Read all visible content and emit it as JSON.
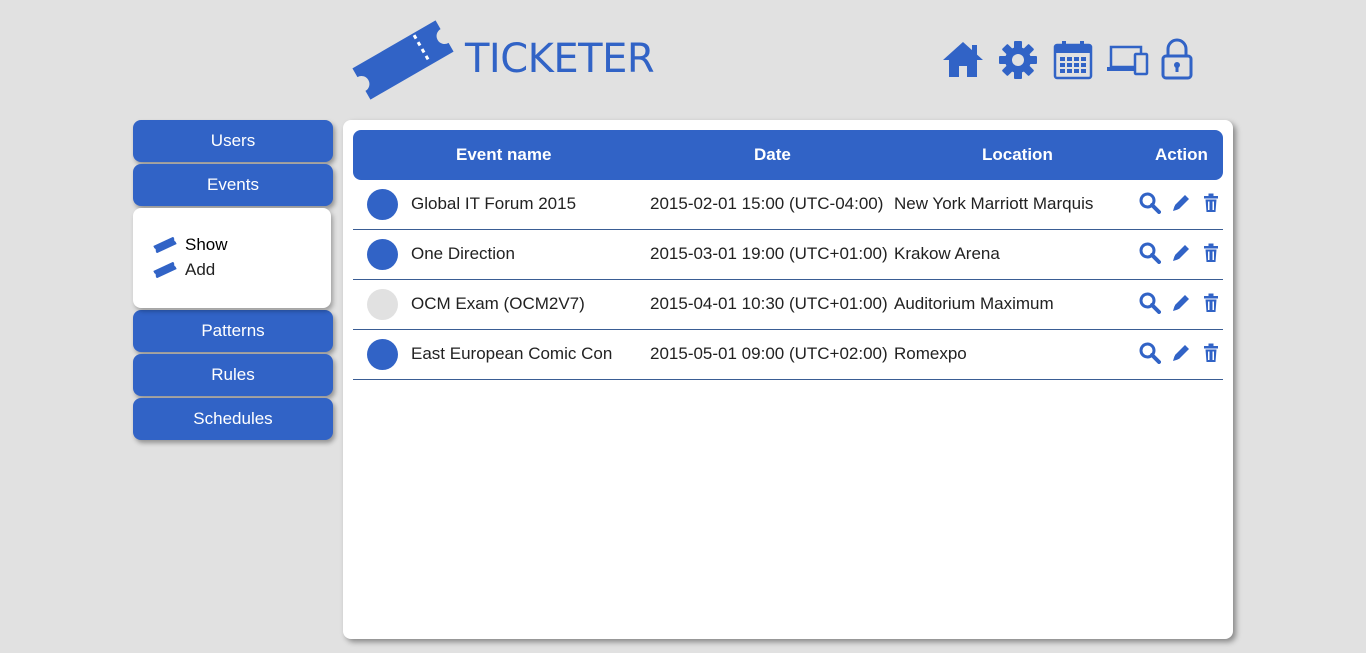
{
  "brand": {
    "name": "TICKETER"
  },
  "colors": {
    "accent": "#3163c6",
    "inactive_dot": "#e1e1e1",
    "background": "#e1e1e1"
  },
  "topnav": [
    {
      "name": "home-icon"
    },
    {
      "name": "gear-icon"
    },
    {
      "name": "calendar-icon"
    },
    {
      "name": "devices-icon"
    },
    {
      "name": "lock-icon"
    }
  ],
  "sidebar": {
    "users": "Users",
    "events": "Events",
    "events_submenu": {
      "show": "Show",
      "add": "Add"
    },
    "patterns": "Patterns",
    "rules": "Rules",
    "schedules": "Schedules"
  },
  "table": {
    "headers": {
      "name": "Event name",
      "date": "Date",
      "location": "Location",
      "action": "Action"
    },
    "rows": [
      {
        "name": "Global IT Forum 2015",
        "date": "2015-02-01 15:00 (UTC-04:00)",
        "location": "New York Marriott Marquis",
        "active": true
      },
      {
        "name": "One Direction",
        "date": "2015-03-01 19:00 (UTC+01:00)",
        "location": "Krakow Arena",
        "active": true
      },
      {
        "name": "OCM Exam (OCM2V7)",
        "date": "2015-04-01 10:30 (UTC+01:00)",
        "location": "Auditorium Maximum",
        "active": false
      },
      {
        "name": "East European Comic Con",
        "date": "2015-05-01 09:00 (UTC+02:00)",
        "location": "Romexpo",
        "active": true
      }
    ],
    "row_actions": [
      "search-icon",
      "pencil-icon",
      "trash-icon"
    ]
  }
}
